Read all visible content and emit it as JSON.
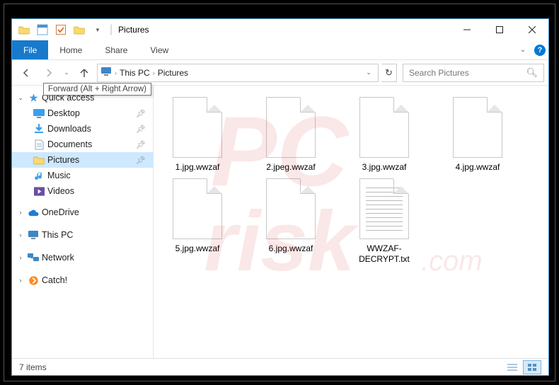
{
  "window": {
    "title": "Pictures",
    "tabs": {
      "file": "File",
      "home": "Home",
      "share": "Share",
      "view": "View"
    }
  },
  "nav": {
    "tooltip": "Forward (Alt + Right Arrow)"
  },
  "breadcrumb": {
    "root_icon": "pc-icon",
    "items": [
      "This PC",
      "Pictures"
    ]
  },
  "search": {
    "placeholder": "Search Pictures"
  },
  "sidebar": {
    "quick_access": {
      "label": "Quick access",
      "items": [
        {
          "label": "Desktop",
          "pinned": true
        },
        {
          "label": "Downloads",
          "pinned": true
        },
        {
          "label": "Documents",
          "pinned": true
        },
        {
          "label": "Pictures",
          "pinned": true,
          "selected": true
        },
        {
          "label": "Music",
          "pinned": false
        },
        {
          "label": "Videos",
          "pinned": false
        }
      ]
    },
    "onedrive": "OneDrive",
    "this_pc": "This PC",
    "network": "Network",
    "catch": "Catch!"
  },
  "files": [
    {
      "name": "1.jpg.wwzaf",
      "kind": "blank"
    },
    {
      "name": "2.jpeg.wwzaf",
      "kind": "blank"
    },
    {
      "name": "3.jpg.wwzaf",
      "kind": "blank"
    },
    {
      "name": "4.jpg.wwzaf",
      "kind": "blank"
    },
    {
      "name": "5.jpg.wwzaf",
      "kind": "blank"
    },
    {
      "name": "6.jpg.wwzaf",
      "kind": "blank"
    },
    {
      "name": "WWZAF-DECRYPT.txt",
      "kind": "text"
    }
  ],
  "status": {
    "count_label": "7 items"
  }
}
